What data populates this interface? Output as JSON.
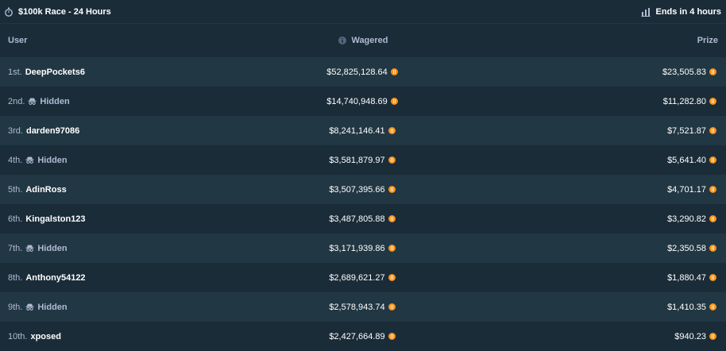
{
  "race": {
    "title": "$100k Race - 24 Hours",
    "ends": "Ends in 4 hours"
  },
  "headers": {
    "user": "User",
    "wagered": "Wagered",
    "prize": "Prize"
  },
  "icons": {
    "race": "stopwatch-icon",
    "ends": "chart-icon",
    "wagered": "info-icon",
    "hidden": "incognito-icon",
    "currency": "bitcoin-coin-icon"
  },
  "colors": {
    "background": "#1a2c38",
    "row_alt": "#213743",
    "text_muted": "#b1bad3",
    "text_bright": "#ffffff",
    "coin": "#f7931a"
  },
  "rows": [
    {
      "rank": "1st.",
      "user": "DeepPockets6",
      "hidden": false,
      "wagered": "$52,825,128.64",
      "prize": "$23,505.83"
    },
    {
      "rank": "2nd.",
      "user": "Hidden",
      "hidden": true,
      "wagered": "$14,740,948.69",
      "prize": "$11,282.80"
    },
    {
      "rank": "3rd.",
      "user": "darden97086",
      "hidden": false,
      "wagered": "$8,241,146.41",
      "prize": "$7,521.87"
    },
    {
      "rank": "4th.",
      "user": "Hidden",
      "hidden": true,
      "wagered": "$3,581,879.97",
      "prize": "$5,641.40"
    },
    {
      "rank": "5th.",
      "user": "AdinRoss",
      "hidden": false,
      "wagered": "$3,507,395.66",
      "prize": "$4,701.17"
    },
    {
      "rank": "6th.",
      "user": "Kingalston123",
      "hidden": false,
      "wagered": "$3,487,805.88",
      "prize": "$3,290.82"
    },
    {
      "rank": "7th.",
      "user": "Hidden",
      "hidden": true,
      "wagered": "$3,171,939.86",
      "prize": "$2,350.58"
    },
    {
      "rank": "8th.",
      "user": "Anthony54122",
      "hidden": false,
      "wagered": "$2,689,621.27",
      "prize": "$1,880.47"
    },
    {
      "rank": "9th.",
      "user": "Hidden",
      "hidden": true,
      "wagered": "$2,578,943.74",
      "prize": "$1,410.35"
    },
    {
      "rank": "10th.",
      "user": "xposed",
      "hidden": false,
      "wagered": "$2,427,664.89",
      "prize": "$940.23"
    }
  ]
}
